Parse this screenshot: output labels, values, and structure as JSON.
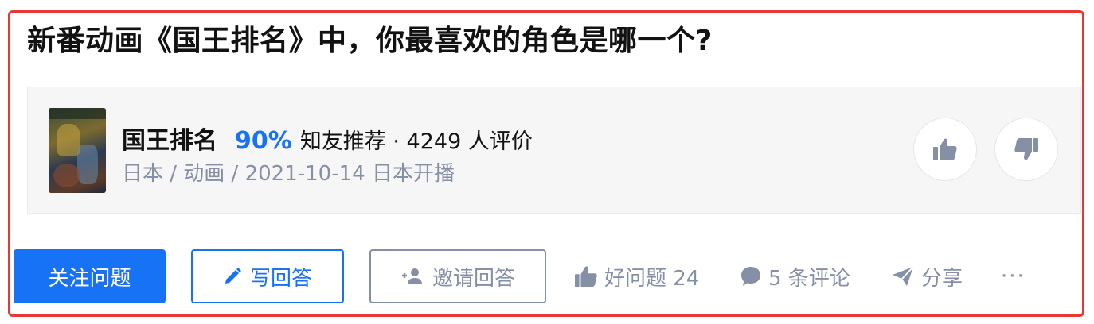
{
  "question": {
    "title": "新番动画《国王排名》中，你最喜欢的角色是哪一个?"
  },
  "work_card": {
    "name": "国王排名",
    "recommend_percent": "90%",
    "recommend_text": "知友推荐 · 4249 人评价",
    "meta": "日本 / 动画 / 2021-10-14 日本开播",
    "upvote_icon": "thumbs-up-icon",
    "downvote_icon": "thumbs-down-icon"
  },
  "actions": {
    "follow_label": "关注问题",
    "write_label": "写回答",
    "invite_label": "邀请回答",
    "good_question_label": "好问题 24",
    "comments_label": "5 条评论",
    "share_label": "分享",
    "more_label": "···"
  },
  "colors": {
    "accent": "#1772f6",
    "muted": "#8590a6",
    "frame": "#e53935"
  }
}
